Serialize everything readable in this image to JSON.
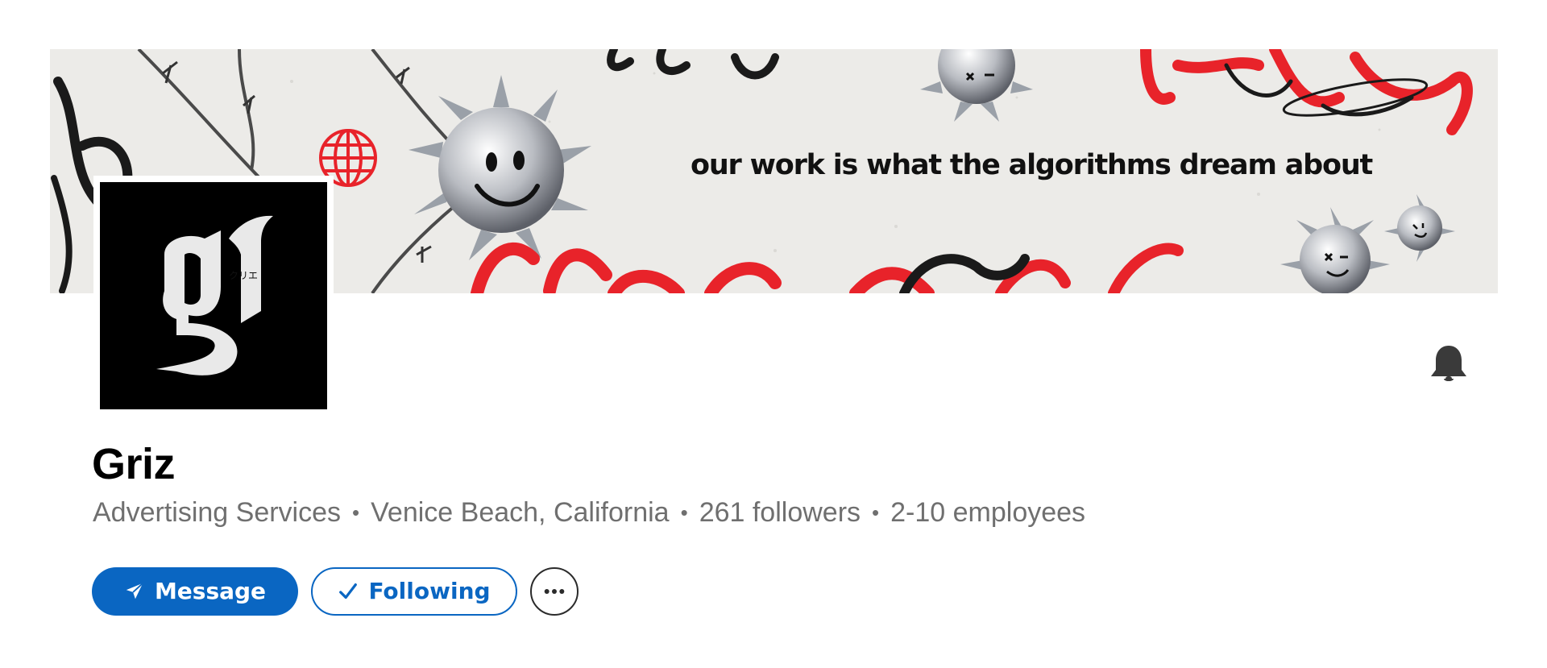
{
  "banner": {
    "tagline": "our work is what the algorithms dream about"
  },
  "logo": {
    "icon": "gothic-g-logo",
    "text": "gr クリエ"
  },
  "company": {
    "name": "Griz",
    "industry": "Advertising Services",
    "location": "Venice Beach, California",
    "followers": "261 followers",
    "employees": "2-10 employees",
    "separator": "•"
  },
  "actions": {
    "message_label": "Message",
    "following_label": "Following",
    "more_label": "···"
  },
  "icons": {
    "notification": "bell-icon",
    "message": "send-icon",
    "following": "checkmark-icon",
    "more": "more-icon"
  },
  "colors": {
    "accent": "#0a66c2",
    "meta_text": "#6f6f6f",
    "banner_red": "#e8232a"
  }
}
